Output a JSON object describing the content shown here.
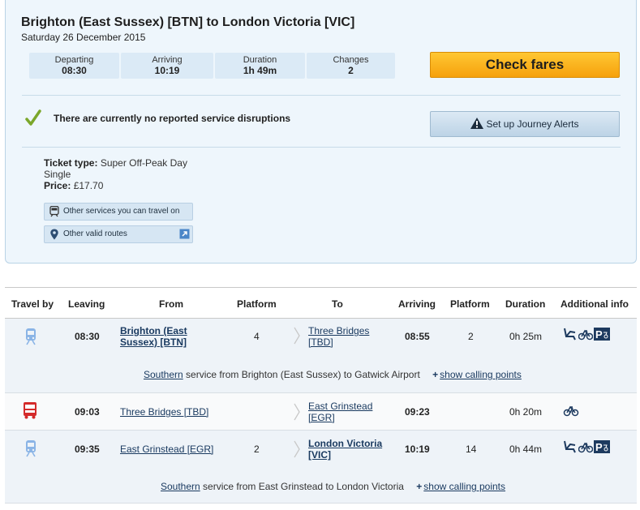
{
  "summary": {
    "route": "Brighton (East Sussex) [BTN] to London Victoria [VIC]",
    "date": "Saturday 26 December 2015",
    "stats": [
      {
        "label": "Departing",
        "value": "08:30"
      },
      {
        "label": "Arriving",
        "value": "10:19"
      },
      {
        "label": "Duration",
        "value": "1h 49m"
      },
      {
        "label": "Changes",
        "value": "2"
      }
    ],
    "check_fares_label": "Check fares",
    "disruption_text": "There are currently no reported service disruptions",
    "alerts_label": "Set up Journey Alerts",
    "ticket_type_label": "Ticket type:",
    "ticket_type_value": "Super Off-Peak Day",
    "ticket_type_value2": "Single",
    "price_label": "Price:",
    "price_value": "£17.70",
    "other_services_label": "Other services you can travel on",
    "other_routes_label": "Other valid routes"
  },
  "table": {
    "headers": {
      "travel_by": "Travel by",
      "leaving": "Leaving",
      "from": "From",
      "platform": "Platform",
      "to": "To",
      "arriving": "Arriving",
      "platform2": "Platform",
      "duration": "Duration",
      "info": "Additional info"
    },
    "legs": [
      {
        "mode": "train",
        "leaving": "08:30",
        "from_line1": "Brighton (East",
        "from_line2": "Sussex) [BTN]",
        "platform": "4",
        "to_line1": "Three Bridges",
        "to_line2": "[TBD]",
        "arriving": "08:55",
        "arr_platform": "2",
        "duration": "0h 25m",
        "operator": "Southern",
        "service_text": " service from Brighton (East Sussex) to Gatwick Airport",
        "calling_points": "show calling points"
      },
      {
        "mode": "bus",
        "leaving": "09:03",
        "from": "Three Bridges [TBD]",
        "to_line1": "East Grinstead",
        "to_line2": "[EGR]",
        "arriving": "09:23",
        "duration": "0h 20m"
      },
      {
        "mode": "train",
        "leaving": "09:35",
        "from": "East Grinstead [EGR]",
        "platform": "2",
        "to_line1": "London Victoria",
        "to_line2": "[VIC]",
        "arriving": "10:19",
        "arr_platform": "14",
        "duration": "0h 44m",
        "operator": "Southern",
        "service_text": " service from East Grinstead to London Victoria",
        "calling_points": "show calling points"
      }
    ]
  },
  "colors": {
    "panel_bg": "#eef6fc",
    "accent_orange": "#f6a10c",
    "link": "#1a3a60",
    "train_icon": "#5a8fd4",
    "bus_icon": "#d42a2a"
  }
}
